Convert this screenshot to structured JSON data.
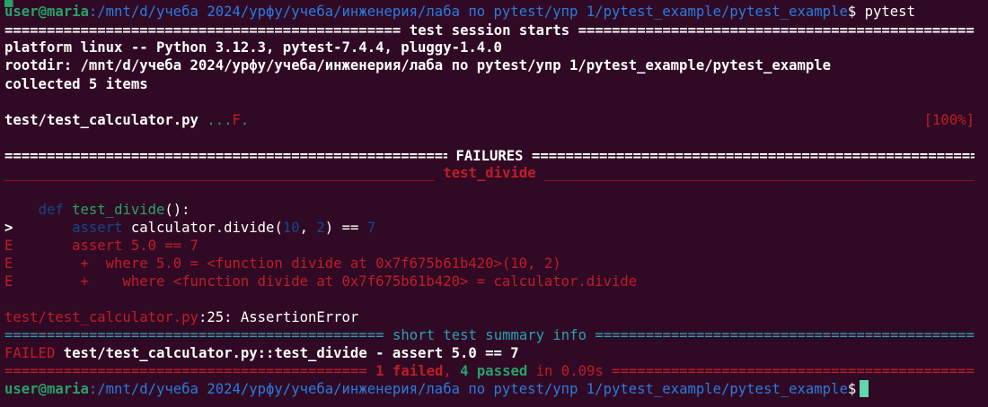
{
  "colors": {
    "background": "#300a24",
    "prompt_user": "#26a269",
    "prompt_path": "#2a7bde",
    "error": "#c01c28",
    "pass": "#26a269",
    "summary_header": "#2aa1b3",
    "cursor": "#5fd7af"
  },
  "prompt1": {
    "user": "user@maria",
    "path": ":/mnt/d/учеба 2024/урфу/учеба/инженерия/лаба по pytest/упр 1/pytest_example/pytest_example",
    "symbol": "$",
    "command": "pytest"
  },
  "session": {
    "header_title": " test session starts ",
    "platform": "platform linux -- Python 3.12.3, pytest-7.4.4, pluggy-1.4.0",
    "rootdir": "rootdir: /mnt/d/учеба 2024/урфу/учеба/инженерия/лаба по pytest/упр 1/pytest_example/pytest_example",
    "collected": "collected 5 items"
  },
  "progress": {
    "file": "test/test_calculator.py ",
    "passed_dots": "...",
    "failed_mark": "F",
    "trailing_dot": ".",
    "percent": "[100%]"
  },
  "failures": {
    "header_title": " FAILURES ",
    "test_title": " test_divide ",
    "code_def_kw": "def",
    "code_def_name": "test_divide",
    "code_def_rest": "():",
    "marker": ">",
    "assert_kw": "assert",
    "assert_call": " calculator.divide(",
    "arg1": "10",
    "comma": ", ",
    "arg2": "2",
    "assert_cmp": ") == ",
    "expected": "7",
    "error_lines": [
      "E       assert 5.0 == 7",
      "E        +  where 5.0 = <function divide at 0x7f675b61b420>(10, 2)",
      "E        +    where <function divide at 0x7f675b61b420> = calculator.divide"
    ],
    "location_file": "test/test_calculator.py",
    "location_rest": ":25: AssertionError"
  },
  "summary": {
    "header_title": " short test summary info ",
    "failed_label": "FAILED",
    "failed_detail": " test/test_calculator.py::test_divide - assert 5.0 == 7",
    "result_failed": "1 failed",
    "result_sep": ", ",
    "result_passed": "4 passed",
    "result_time": " in 0.09s"
  },
  "prompt2": {
    "user": "user@maria",
    "path": ":/mnt/d/учеба 2024/урфу/учеба/инженерия/лаба по pytest/упр 1/pytest_example/pytest_example",
    "symbol": "$"
  }
}
